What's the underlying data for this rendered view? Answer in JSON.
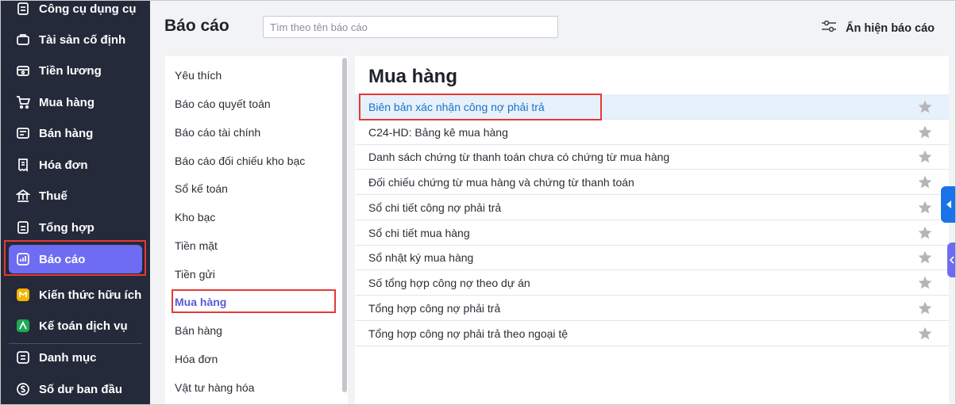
{
  "sidebar": {
    "items": [
      {
        "label": "Công cụ dụng cụ",
        "icon": "tools-icon"
      },
      {
        "label": "Tài sản cố định",
        "icon": "briefcase-icon"
      },
      {
        "label": "Tiền lương",
        "icon": "wallet-icon"
      },
      {
        "label": "Mua hàng",
        "icon": "cart-icon"
      },
      {
        "label": "Bán hàng",
        "icon": "sale-bag-icon"
      },
      {
        "label": "Hóa đơn",
        "icon": "invoice-icon"
      },
      {
        "label": "Thuế",
        "icon": "bank-icon"
      },
      {
        "label": "Tổng hợp",
        "icon": "summary-icon"
      },
      {
        "label": "Báo cáo",
        "icon": "report-chart-icon"
      },
      {
        "label": "Kiến thức hữu ích",
        "icon": "knowledge-icon"
      },
      {
        "label": "Kế toán dịch vụ",
        "icon": "service-icon"
      },
      {
        "label": "Danh mục",
        "icon": "list-icon"
      },
      {
        "label": "Số dư ban đầu",
        "icon": "balance-icon"
      }
    ],
    "active_label": "Báo cáo",
    "active_color": "#6d6cf2",
    "background_color": "#242a3a"
  },
  "header": {
    "title": "Báo cáo",
    "search_placeholder": "Tìm theo tên báo cáo",
    "toggle_label": "Ẩn hiện báo cáo",
    "toggle_icon": "sliders-icon"
  },
  "categories": {
    "items": [
      "Yêu thích",
      "Báo cáo quyết toán",
      "Báo cáo tài chính",
      "Báo cáo đối chiếu kho bạc",
      "Sổ kế toán",
      "Kho bạc",
      "Tiền mặt",
      "Tiền gửi",
      "Mua hàng",
      "Bán hàng",
      "Hóa đơn",
      "Vật tư hàng hóa"
    ],
    "active": "Mua hàng"
  },
  "reports": {
    "title": "Mua hàng",
    "selected": "Biên bản xác nhận công nợ phải trả",
    "items": [
      "Biên bản xác nhận công nợ phải trả",
      "C24-HD: Bảng kê mua hàng",
      "Danh sách chứng từ thanh toán chưa có chứng từ mua hàng",
      "Đối chiếu chứng từ mua hàng và chứng từ thanh toán",
      "Sổ chi tiết công nợ phải trả",
      "Sổ chi tiết mua hàng",
      "Sổ nhật ký mua hàng",
      "Số tổng hợp công nợ theo dự án",
      "Tổng hợp công nợ phải trả",
      "Tổng hợp công nợ phải trả theo ngoại tệ"
    ],
    "star_icon": "star-icon",
    "star_color": "#b3b5ba",
    "selected_text_color": "#1a73c7"
  },
  "highlight_color": "#e53935"
}
